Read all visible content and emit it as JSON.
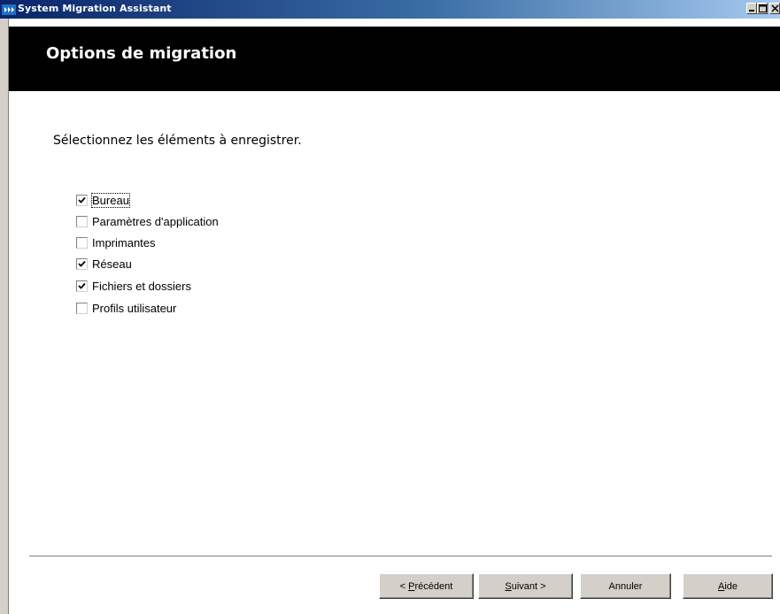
{
  "window": {
    "title": "System Migration Assistant",
    "controls": [
      "minimize-icon",
      "maximize-icon",
      "close-icon"
    ]
  },
  "banner": {
    "title": "Options de migration",
    "logo": "IBM",
    "background": "#000000",
    "title_color": "#ffffff"
  },
  "main": {
    "instruction": "Sélectionnez les éléments à enregistrer.",
    "options": [
      {
        "label": "Bureau",
        "checked": true,
        "focused": true
      },
      {
        "label": "Paramètres d'application",
        "checked": false,
        "focused": false
      },
      {
        "label": "Imprimantes",
        "checked": false,
        "focused": false
      },
      {
        "label": "Réseau",
        "checked": true,
        "focused": false
      },
      {
        "label": "Fichiers et dossiers",
        "checked": true,
        "focused": false
      },
      {
        "label": "Profils utilisateur",
        "checked": false,
        "focused": false
      }
    ]
  },
  "footer": {
    "back_label": "< Précédent",
    "back_mnemonic": "P",
    "next_label": "Suivant >",
    "next_mnemonic": "S",
    "cancel_label": "Annuler",
    "help_label": "Aide",
    "help_mnemonic": "A"
  },
  "colors": {
    "titlebar_start": "#0a246a",
    "titlebar_end": "#a6caf0",
    "button_face": "#d4d0c8",
    "logo_blue": "#1f70c1"
  }
}
